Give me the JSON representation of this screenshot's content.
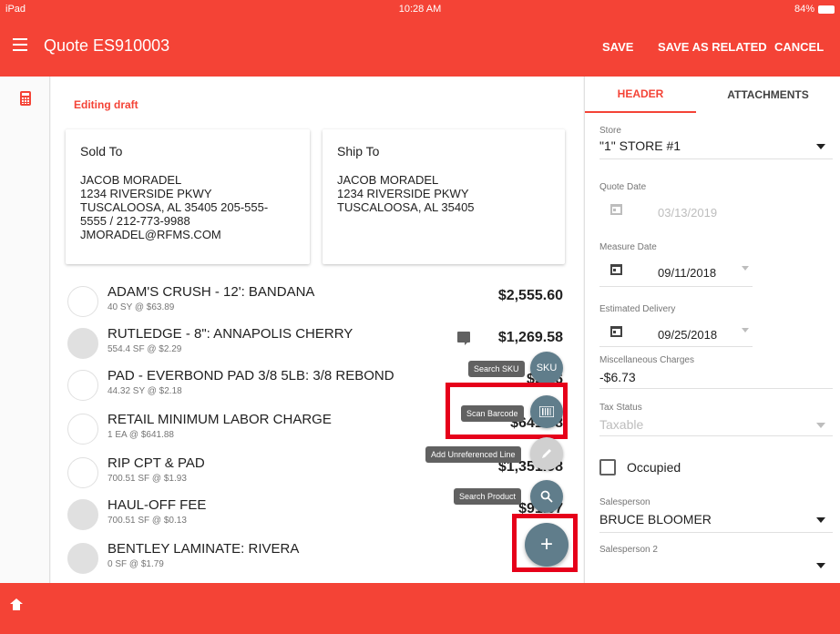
{
  "status_bar": {
    "device": "iPad",
    "time": "10:28 AM",
    "battery": "84%"
  },
  "app_bar": {
    "title": "Quote ES910003",
    "save": "SAVE",
    "save_as_related": "SAVE AS RELATED",
    "cancel": "CANCEL"
  },
  "main": {
    "editing_label": "Editing draft",
    "sold_to": {
      "title": "Sold To",
      "body": "JACOB MORADEL\n1234 RIVERSIDE PKWY\nTUSCALOOSA, AL 35405 205-555-\n5555 / 212-773-9988\nJMORADEL@RFMS.COM"
    },
    "ship_to": {
      "title": "Ship To",
      "body": "JACOB MORADEL\n1234 RIVERSIDE PKWY\nTUSCALOOSA, AL 35405"
    },
    "line_items": [
      {
        "name": "ADAM'S CRUSH - 12': BANDANA",
        "detail": "40 SY @ $63.89",
        "price": "$2,555.60"
      },
      {
        "name": "RUTLEDGE - 8\": ANNAPOLIS CHERRY",
        "detail": "554.4 SF @ $2.29",
        "price": "$1,269.58"
      },
      {
        "name": "PAD - EVERBOND PAD 3/8 5LB: 3/8 REBOND",
        "detail": "44.32 SY @ $2.18",
        "price": "$96.6"
      },
      {
        "name": "RETAIL MINIMUM LABOR CHARGE",
        "detail": "1 EA @ $641.88",
        "price": "$641.88"
      },
      {
        "name": "RIP CPT & PAD",
        "detail": "700.51 SF @ $1.93",
        "price": "$1,351.98"
      },
      {
        "name": "HAUL-OFF FEE",
        "detail": "700.51 SF @ $0.13",
        "price": "$91.07"
      },
      {
        "name": "BENTLEY LAMINATE: RIVERA",
        "detail": "0 SF @ $1.79",
        "price": ""
      }
    ],
    "fab": {
      "search_sku_label": "Search SKU",
      "sku_text": "SKU",
      "scan_barcode_label": "Scan Barcode",
      "add_unreferenced_label": "Add Unreferenced Line",
      "search_product_label": "Search Product",
      "main_icon": "+"
    }
  },
  "side_panel": {
    "tabs": [
      "HEADER",
      "ATTACHMENTS"
    ],
    "store_label": "Store",
    "store_value": "\"1\" STORE #1",
    "quote_date_label": "Quote Date",
    "quote_date_value": "03/13/2019",
    "measure_date_label": "Measure Date",
    "measure_date_value": "09/11/2018",
    "estimated_delivery_label": "Estimated Delivery",
    "estimated_delivery_value": "09/25/2018",
    "misc_charges_label": "Miscellaneous Charges",
    "misc_charges_value": "-$6.73",
    "tax_status_label": "Tax Status",
    "tax_status_value": "Taxable",
    "occupied_label": "Occupied",
    "salesperson_label": "Salesperson",
    "salesperson_value": "BRUCE BLOOMER",
    "salesperson2_label": "Salesperson 2"
  },
  "colors": {
    "accent": "#f44336",
    "fab": "#607d8b",
    "highlight": "#e6001a"
  }
}
